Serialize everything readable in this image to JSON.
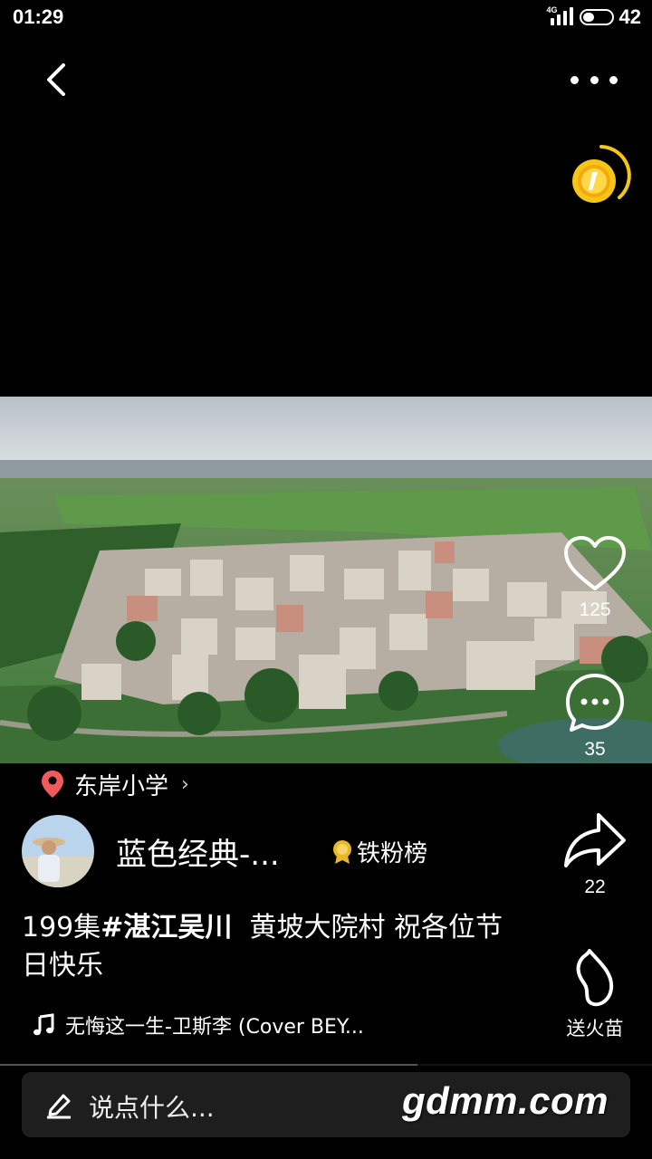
{
  "status_bar": {
    "time": "01:29",
    "network": "4G",
    "battery": "42",
    "battery_level": 0.42
  },
  "header": {
    "back_icon": "chevron-left-icon",
    "more_icon": "more-horizontal-icon",
    "coin_icon": "gold-coin-icon"
  },
  "actions": {
    "like_count": "125",
    "comment_count": "35",
    "share_count": "22",
    "gift_label": "送火苗"
  },
  "post": {
    "location": "东岸小学",
    "author_name": "蓝色经典-...",
    "fan_badge": "铁粉榜",
    "caption_prefix": "199集",
    "caption_hashtag": "#湛江吴川",
    "caption_rest": "黄坡大院村 祝各位节日快乐",
    "music": "无悔这一生-卫斯李 (Cover BEY..."
  },
  "playback": {
    "progress": 0.64
  },
  "comment_bar": {
    "placeholder": "说点什么...",
    "watermark": "gdmm.com"
  },
  "colors": {
    "background": "#000000",
    "location_pin": "#f05a5a",
    "coin": "#f5c518",
    "badge_gold": "#e8b923"
  }
}
